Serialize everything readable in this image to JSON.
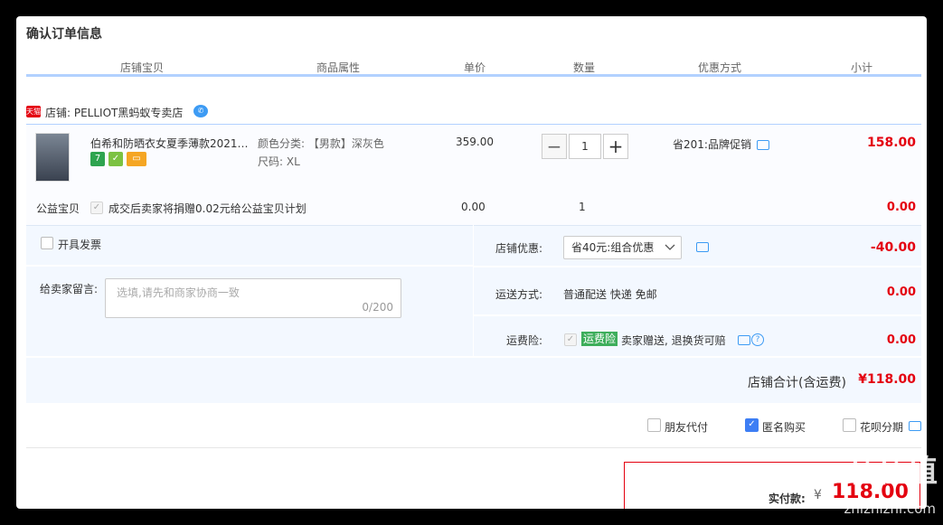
{
  "page": {
    "title": "确认订单信息"
  },
  "columns": [
    "店铺宝贝",
    "商品属性",
    "单价",
    "数量",
    "优惠方式",
    "小计"
  ],
  "shop": {
    "tag": "天猫",
    "name": "店铺: PELLIOT黑蚂蚁专卖店"
  },
  "product": {
    "title": "伯希和防晒衣女夏季薄款2021…",
    "attr_color": "颜色分类: 【男款】深灰色",
    "attr_size": "尺码: XL",
    "price": "359.00",
    "qty": "1",
    "qty_minus": "−",
    "qty_plus": "+",
    "discount": "省201:品牌促销",
    "subtotal": "158.00"
  },
  "charity": {
    "label": "公益宝贝",
    "text": "成交后卖家将捐赠0.02元给公益宝贝计划",
    "price": "0.00",
    "qty": "1",
    "subtotal": "0.00"
  },
  "invoice": {
    "label": "开具发票"
  },
  "message": {
    "label": "给卖家留言:",
    "placeholder": "选填,请先和商家协商一致",
    "counter": "0/200"
  },
  "shop_discount": {
    "label": "店铺优惠:",
    "value": "省40元:组合优惠",
    "amount": "-40.00"
  },
  "shipping": {
    "label": "运送方式:",
    "value": "普通配送 快递 免邮",
    "amount": "0.00"
  },
  "insurance": {
    "label": "运费险:",
    "badge": "运费险",
    "text": "卖家赠送, 退换货可赔",
    "amount": "0.00"
  },
  "shop_total": {
    "label": "店铺合计(含运费)",
    "amount": "¥118.00"
  },
  "options": {
    "friend_pay": "朋友代付",
    "anonymous": "匿名购买",
    "huabei": "花呗分期"
  },
  "payment": {
    "label": "实付款:",
    "currency": "¥",
    "amount": "118.00"
  },
  "watermark": {
    "big": "值值值",
    "small": "zhizhizhi.com"
  }
}
